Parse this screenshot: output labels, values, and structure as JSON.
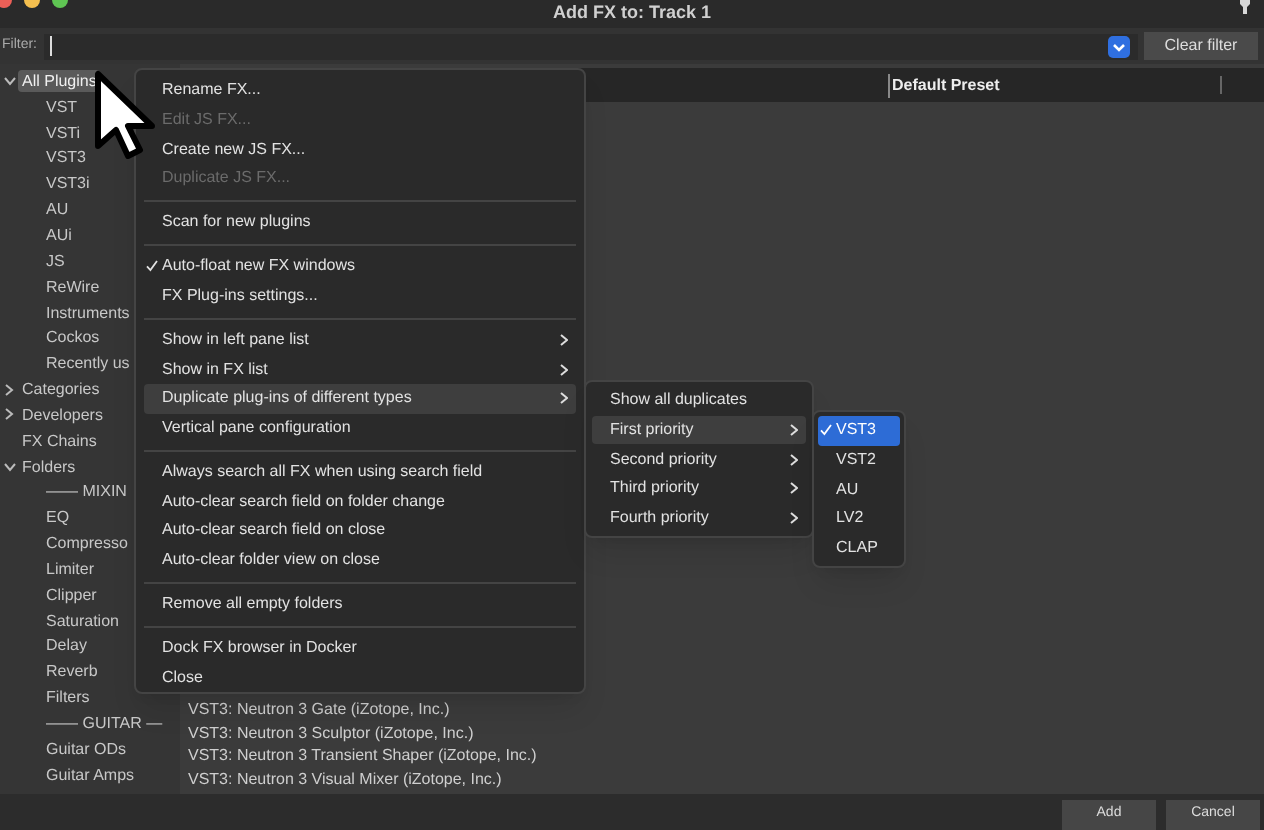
{
  "window": {
    "title": "Add FX to: Track 1"
  },
  "filter": {
    "label": "Filter:",
    "clear_button": "Clear filter"
  },
  "tree": [
    {
      "label": "All Plugins",
      "expanded": true,
      "selected": true,
      "children": [
        {
          "label": "VST",
          "selected": false
        },
        {
          "label": "VSTi",
          "selected": false
        },
        {
          "label": "VST3",
          "selected": false
        },
        {
          "label": "VST3i",
          "selected": false
        },
        {
          "label": "AU",
          "selected": false
        },
        {
          "label": "AUi",
          "selected": false
        },
        {
          "label": "JS",
          "selected": false
        },
        {
          "label": "ReWire",
          "selected": false
        },
        {
          "label": "Instruments",
          "selected": false
        },
        {
          "label": "Cockos",
          "selected": false
        },
        {
          "label": "Recently us",
          "selected": false
        }
      ]
    },
    {
      "label": "Categories",
      "expanded": false,
      "selected": false
    },
    {
      "label": "Developers",
      "expanded": false,
      "selected": false
    },
    {
      "label": "FX Chains",
      "selected": false
    },
    {
      "label": "Folders",
      "expanded": true,
      "selected": false,
      "children": [
        {
          "label": "—— MIXIN",
          "selected": false
        },
        {
          "label": "EQ",
          "selected": false
        },
        {
          "label": "Compresso",
          "selected": false
        },
        {
          "label": "Limiter",
          "selected": false
        },
        {
          "label": "Clipper",
          "selected": false
        },
        {
          "label": "Saturation",
          "selected": false
        },
        {
          "label": "Delay",
          "selected": false
        },
        {
          "label": "Reverb",
          "selected": false
        },
        {
          "label": "Filters",
          "selected": false
        },
        {
          "label": "—— GUITAR —",
          "selected": false
        },
        {
          "label": "Guitar ODs",
          "selected": false
        },
        {
          "label": "Guitar Amps",
          "selected": false
        }
      ]
    }
  ],
  "list": {
    "columns": [
      "Default Preset"
    ],
    "rows": [
      "VST3: Neutron 3 Gate (iZotope, Inc.)",
      "VST3: Neutron 3 Sculptor (iZotope, Inc.)",
      "VST3: Neutron 3 Transient Shaper (iZotope, Inc.)",
      "VST3: Neutron 3 Visual Mixer (iZotope, Inc.)"
    ]
  },
  "context_menu": {
    "items": [
      {
        "kind": "item",
        "label": "Rename FX...",
        "disabled": false,
        "checked": false,
        "submenu": false,
        "selected": false
      },
      {
        "kind": "item",
        "label": "Edit JS FX...",
        "disabled": true,
        "checked": false,
        "submenu": false,
        "selected": false
      },
      {
        "kind": "item",
        "label": "Create new JS FX...",
        "disabled": false,
        "checked": false,
        "submenu": false,
        "selected": false
      },
      {
        "kind": "item",
        "label": "Duplicate JS FX...",
        "disabled": true,
        "checked": false,
        "submenu": false,
        "selected": false
      },
      {
        "kind": "separator"
      },
      {
        "kind": "item",
        "label": "Scan for new plugins",
        "disabled": false,
        "checked": false,
        "submenu": false,
        "selected": false
      },
      {
        "kind": "separator"
      },
      {
        "kind": "item",
        "label": "Auto-float new FX windows",
        "disabled": false,
        "checked": true,
        "submenu": false,
        "selected": false
      },
      {
        "kind": "item",
        "label": "FX Plug-ins settings...",
        "disabled": false,
        "checked": false,
        "submenu": false,
        "selected": false
      },
      {
        "kind": "separator"
      },
      {
        "kind": "item",
        "label": "Show in left pane list",
        "disabled": false,
        "checked": false,
        "submenu": true,
        "selected": false
      },
      {
        "kind": "item",
        "label": "Show in FX list",
        "disabled": false,
        "checked": false,
        "submenu": true,
        "selected": false
      },
      {
        "kind": "item",
        "label": "Duplicate plug-ins of different types",
        "disabled": false,
        "checked": false,
        "submenu": true,
        "selected": true
      },
      {
        "kind": "item",
        "label": "Vertical pane configuration",
        "disabled": false,
        "checked": false,
        "submenu": false,
        "selected": false
      },
      {
        "kind": "separator"
      },
      {
        "kind": "item",
        "label": "Always search all FX when using search field",
        "disabled": false,
        "checked": false,
        "submenu": false,
        "selected": false
      },
      {
        "kind": "item",
        "label": "Auto-clear search field on folder change",
        "disabled": false,
        "checked": false,
        "submenu": false,
        "selected": false
      },
      {
        "kind": "item",
        "label": "Auto-clear search field on close",
        "disabled": false,
        "checked": false,
        "submenu": false,
        "selected": false
      },
      {
        "kind": "item",
        "label": "Auto-clear folder view on close",
        "disabled": false,
        "checked": false,
        "submenu": false,
        "selected": false
      },
      {
        "kind": "separator"
      },
      {
        "kind": "item",
        "label": "Remove all empty folders",
        "disabled": false,
        "checked": false,
        "submenu": false,
        "selected": false
      },
      {
        "kind": "separator"
      },
      {
        "kind": "item",
        "label": "Dock FX browser in Docker",
        "disabled": false,
        "checked": false,
        "submenu": false,
        "selected": false
      },
      {
        "kind": "item",
        "label": "Close",
        "disabled": false,
        "checked": false,
        "submenu": false,
        "selected": false
      }
    ]
  },
  "submenu": {
    "items": [
      {
        "kind": "item",
        "label": "Show all duplicates",
        "disabled": false,
        "checked": false,
        "submenu": false,
        "selected": false
      },
      {
        "kind": "item",
        "label": "First priority",
        "disabled": false,
        "checked": false,
        "submenu": true,
        "selected": true
      },
      {
        "kind": "item",
        "label": "Second priority",
        "disabled": false,
        "checked": false,
        "submenu": true,
        "selected": false
      },
      {
        "kind": "item",
        "label": "Third priority",
        "disabled": false,
        "checked": false,
        "submenu": true,
        "selected": false
      },
      {
        "kind": "item",
        "label": "Fourth priority",
        "disabled": false,
        "checked": false,
        "submenu": true,
        "selected": false
      }
    ]
  },
  "priority_menu": {
    "items": [
      {
        "kind": "item",
        "label": "VST3",
        "disabled": false,
        "checked": true,
        "submenu": false,
        "selected": true
      },
      {
        "kind": "item",
        "label": "VST2",
        "disabled": false,
        "checked": false,
        "submenu": false,
        "selected": false
      },
      {
        "kind": "item",
        "label": "AU",
        "disabled": false,
        "checked": false,
        "submenu": false,
        "selected": false
      },
      {
        "kind": "item",
        "label": "LV2",
        "disabled": false,
        "checked": false,
        "submenu": false,
        "selected": false
      },
      {
        "kind": "item",
        "label": "CLAP",
        "disabled": false,
        "checked": false,
        "submenu": false,
        "selected": false
      }
    ]
  },
  "buttons": [
    "Add",
    "Cancel"
  ]
}
